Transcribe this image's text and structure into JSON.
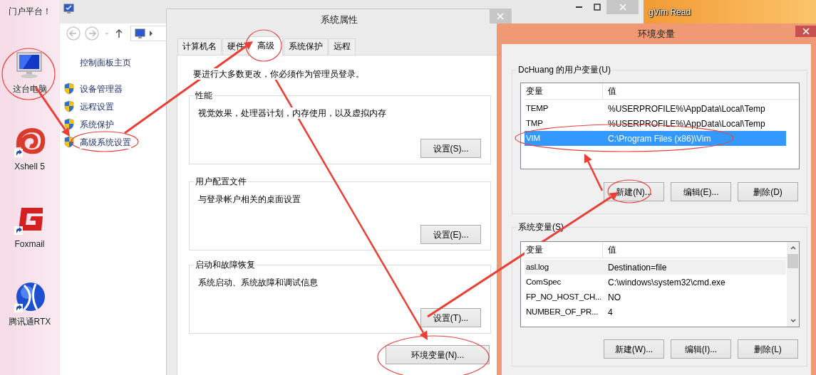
{
  "desktop": {
    "icons": [
      {
        "label": "门户平台！"
      },
      {
        "label": "这台电脑"
      },
      {
        "label": "Xshell 5"
      },
      {
        "label": "Foxmail"
      },
      {
        "label": "腾讯通RTX"
      }
    ],
    "corner_icon": {
      "label": "gVim Read"
    }
  },
  "control_panel": {
    "home_link": "控制面板主页",
    "links": [
      {
        "label": "设备管理器"
      },
      {
        "label": "远程设置"
      },
      {
        "label": "系统保护"
      },
      {
        "label": "高级系统设置"
      }
    ]
  },
  "system_properties": {
    "title": "系统属性",
    "tabs": [
      {
        "label": "计算机名",
        "selected": false
      },
      {
        "label": "硬件",
        "selected": false
      },
      {
        "label": "高级",
        "selected": true
      },
      {
        "label": "系统保护",
        "selected": false
      },
      {
        "label": "远程",
        "selected": false
      }
    ],
    "notice": "要进行大多数更改，你必须作为管理员登录。",
    "groups": [
      {
        "title": "性能",
        "description": "视觉效果，处理器计划，内存使用，以及虚拟内存",
        "button": "设置(S)..."
      },
      {
        "title": "用户配置文件",
        "description": "与登录帐户相关的桌面设置",
        "button": "设置(E)..."
      },
      {
        "title": "启动和故障恢复",
        "description": "系统启动、系统故障和调试信息",
        "button": "设置(T)..."
      }
    ],
    "env_button": "环境变量(N)..."
  },
  "environment_variables": {
    "title": "环境变量",
    "lists": [
      {
        "title": "DcHuang 的用户变量(U)",
        "focused": true,
        "scrollbar": false,
        "columns": [
          "变量",
          "值"
        ],
        "rows": [
          {
            "name": "TEMP",
            "value": "%USERPROFILE%\\AppData\\Local\\Temp",
            "selected": false
          },
          {
            "name": "TMP",
            "value": "%USERPROFILE%\\AppData\\Local\\Temp",
            "selected": false
          },
          {
            "name": "VIM",
            "value": "C:\\Program Files (x86)\\Vim",
            "selected": true
          }
        ],
        "buttons": [
          "新建(N)...",
          "编辑(E)...",
          "删除(D)"
        ]
      },
      {
        "title": "系统变量(S)",
        "focused": false,
        "scrollbar": true,
        "columns": [
          "变量",
          "值"
        ],
        "rows": [
          {
            "name": "asl.log",
            "value": "Destination=file",
            "selected": true
          },
          {
            "name": "ComSpec",
            "value": "C:\\windows\\system32\\cmd.exe",
            "selected": false
          },
          {
            "name": "FP_NO_HOST_CH...",
            "value": "NO",
            "selected": false
          },
          {
            "name": "NUMBER_OF_PR...",
            "value": "4",
            "selected": false
          }
        ],
        "buttons": [
          "新建(W)...",
          "编辑(I)...",
          "删除(L)"
        ]
      }
    ]
  }
}
